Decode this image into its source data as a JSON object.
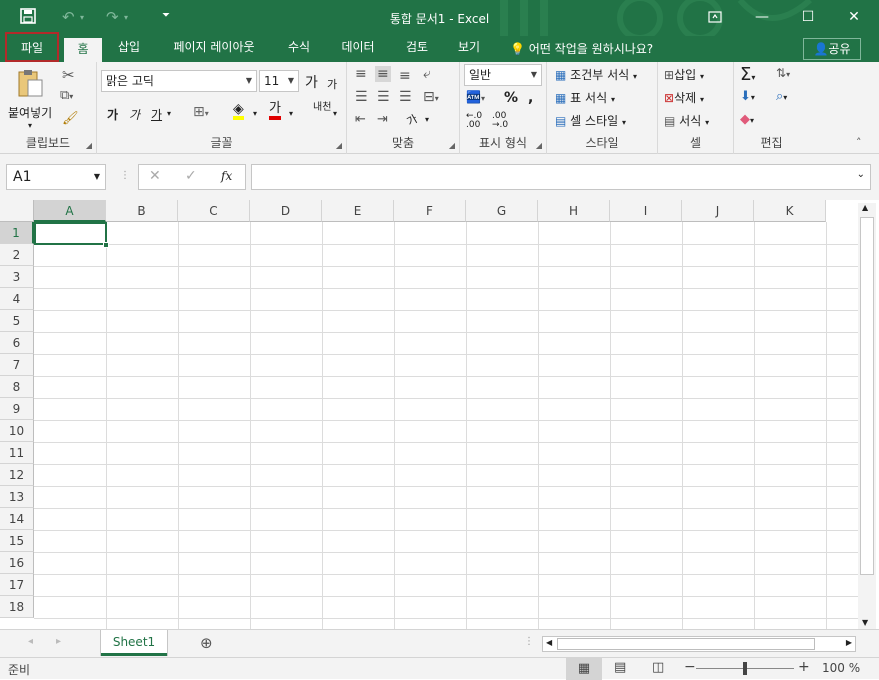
{
  "window": {
    "title": "통합 문서1 - Excel",
    "icons": [
      "save-icon",
      "undo-icon",
      "redo-icon",
      "customize-qat-icon",
      "ribbon-display-icon",
      "minimize-icon",
      "maximize-icon",
      "close-icon"
    ]
  },
  "tabs": {
    "file": "파일",
    "home": "홈",
    "insert": "삽입",
    "page_layout": "페이지 레이아웃",
    "formulas": "수식",
    "data": "데이터",
    "review": "검토",
    "view": "보기",
    "tell_me": "어떤 작업을 원하시나요?",
    "share": "공유"
  },
  "ribbon": {
    "clipboard": {
      "label": "클립보드",
      "paste": "붙여넣기"
    },
    "font": {
      "label": "글꼴",
      "font_name": "맑은 고딕",
      "font_size": "11",
      "grow": "가",
      "shrink": "가",
      "bold": "가",
      "italic": "가",
      "underline": "가",
      "font_color_glyph": "가",
      "phonetic": "내천"
    },
    "alignment": {
      "label": "맞춤",
      "orientation": "가"
    },
    "number": {
      "label": "표시 형식",
      "format": "일반"
    },
    "styles": {
      "label": "스타일",
      "conditional": "조건부 서식",
      "table": "표 서식",
      "cell_styles": "셀 스타일"
    },
    "cells": {
      "label": "셀",
      "insert": "삽입",
      "delete": "삭제",
      "format": "서식"
    },
    "editing": {
      "label": "편집"
    }
  },
  "formula_bar": {
    "name_box": "A1",
    "fx": "fx",
    "value": ""
  },
  "grid": {
    "columns": [
      "A",
      "B",
      "C",
      "D",
      "E",
      "F",
      "G",
      "H",
      "I",
      "J",
      "K"
    ],
    "rows": [
      "1",
      "2",
      "3",
      "4",
      "5",
      "6",
      "7",
      "8",
      "9",
      "10",
      "11",
      "12",
      "13",
      "14",
      "15",
      "16",
      "17",
      "18"
    ],
    "selected": "A1"
  },
  "sheets": {
    "tabs": [
      "Sheet1"
    ],
    "active": "Sheet1"
  },
  "status": {
    "ready": "준비",
    "zoom": "100 %"
  },
  "colors": {
    "accent": "#217346",
    "file_highlight": "#b22a2a",
    "font_color": "#e00000",
    "fill_color": "#ffff00"
  }
}
